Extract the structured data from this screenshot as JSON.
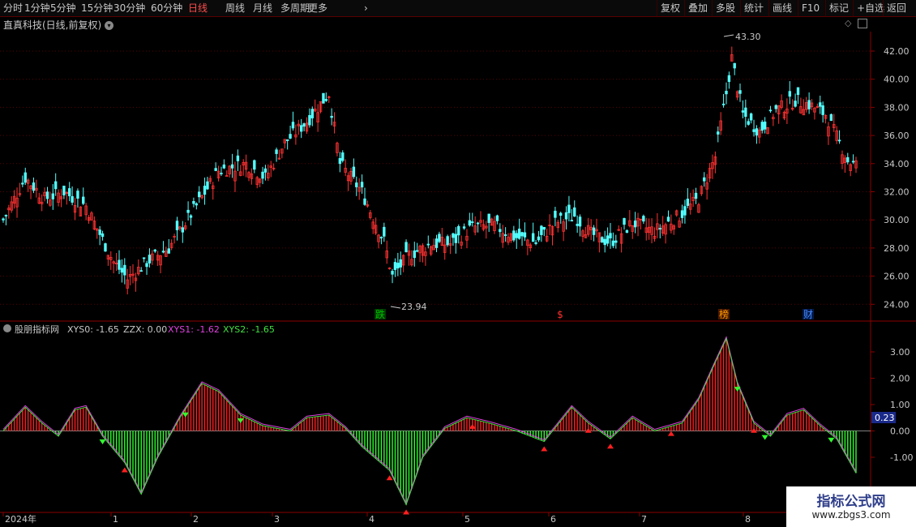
{
  "toolbar": {
    "left_items": [
      "分时",
      "1分钟",
      "5分钟",
      "15分钟",
      "30分钟",
      "60分钟",
      "日线",
      "周线",
      "月线",
      "多周期",
      "更多"
    ],
    "active": "日线",
    "right_items": [
      "复权",
      "叠加",
      "多股",
      "统计",
      "画线",
      "F10",
      "标记",
      "+自选",
      "返回"
    ]
  },
  "stock": {
    "title": "直真科技(日线,前复权)"
  },
  "price_chart": {
    "yticks": [
      "42.00",
      "40.00",
      "38.00",
      "36.00",
      "34.00",
      "32.00",
      "30.00",
      "28.00",
      "26.00",
      "24.00"
    ],
    "high_label": "43.30",
    "low_label": "23.94",
    "markers": [
      {
        "text": "跌",
        "color": "#00c000",
        "bg": "#003a00"
      },
      {
        "text": "$",
        "color": "#ff3030",
        "bg": ""
      },
      {
        "text": "榜",
        "color": "#ff9900",
        "bg": "#4a1a00"
      },
      {
        "text": "财",
        "color": "#4a8aff",
        "bg": "#001a4a"
      }
    ]
  },
  "indicator": {
    "name": "股朋指标网",
    "xys0": "XYS0: -1.65",
    "zzx": "ZZX: 0.00",
    "xys1": "XYS1: -1.62",
    "xys2": "XYS2: -1.65",
    "yticks": [
      "3.00",
      "2.00",
      "1.00",
      "0.00",
      "-1.00"
    ],
    "current_value": "0.23",
    "colors": {
      "xys1": "#e040e0",
      "xys2": "#40e040"
    }
  },
  "x_axis": {
    "labels": [
      "2024年",
      "1",
      "2",
      "3",
      "4",
      "5",
      "6",
      "7",
      "8"
    ]
  },
  "watermark": {
    "title": "指标公式网",
    "url": "www.zbgs3.com"
  }
}
